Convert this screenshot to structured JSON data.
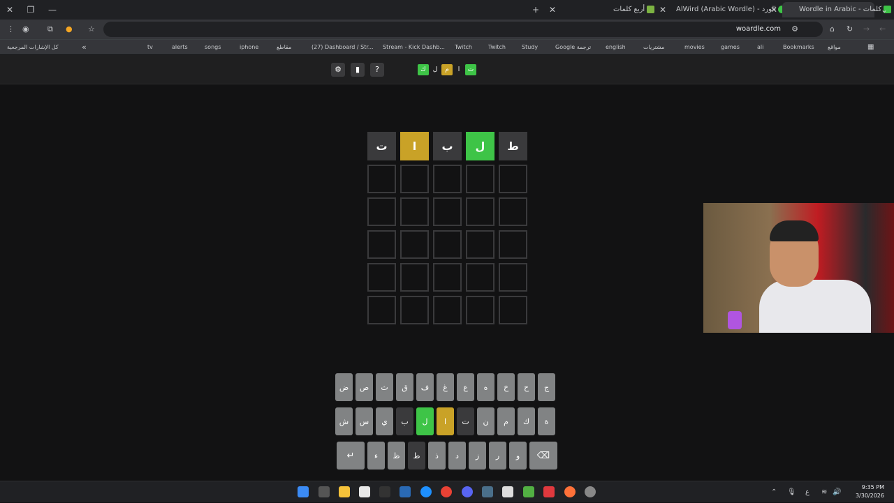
{
  "browser": {
    "tabs": [
      {
        "title": "Wordle in Arabic - كلمات",
        "active": true,
        "color": "#3ec447"
      },
      {
        "title": "AlWird (Arabic Wordle) - الورد",
        "active": false,
        "color": "#3ec447"
      },
      {
        "title": "أربع كلمات",
        "active": false,
        "color": "#7cb342"
      }
    ],
    "url": "woardle.com",
    "bookmarks": [
      "مواقع",
      "Bookmarks",
      "ali",
      "games",
      "movies",
      "مشتريات",
      "english",
      "Google ترجمة",
      "Study",
      "Twitch",
      "Twitch",
      "Stream - Kick Dashb...",
      "(27) Dashboard / Str...",
      "مقاطع",
      "iphone",
      "songs",
      "alerts",
      "tv"
    ],
    "all_bookmarks": "كل الإشارات المرجعية"
  },
  "header": {
    "settings_icon": "gear-icon",
    "stats_icon": "bar-chart-icon",
    "help_label": "?",
    "logo_letters": [
      {
        "char": "ك",
        "color": "#3ec447"
      },
      {
        "char": "ل",
        "color": ""
      },
      {
        "char": "م",
        "color": "#c9a227"
      },
      {
        "char": "ا",
        "color": ""
      },
      {
        "char": "ت",
        "color": "#3ec447"
      }
    ]
  },
  "board": {
    "rows": [
      [
        {
          "char": "ط",
          "state": "gray"
        },
        {
          "char": "ل",
          "state": "green"
        },
        {
          "char": "ب",
          "state": "gray"
        },
        {
          "char": "ا",
          "state": "yellow"
        },
        {
          "char": "ت",
          "state": "gray"
        }
      ],
      [
        {
          "char": "",
          "state": ""
        },
        {
          "char": "",
          "state": ""
        },
        {
          "char": "",
          "state": ""
        },
        {
          "char": "",
          "state": ""
        },
        {
          "char": "",
          "state": ""
        }
      ],
      [
        {
          "char": "",
          "state": ""
        },
        {
          "char": "",
          "state": ""
        },
        {
          "char": "",
          "state": ""
        },
        {
          "char": "",
          "state": ""
        },
        {
          "char": "",
          "state": ""
        }
      ],
      [
        {
          "char": "",
          "state": ""
        },
        {
          "char": "",
          "state": ""
        },
        {
          "char": "",
          "state": ""
        },
        {
          "char": "",
          "state": ""
        },
        {
          "char": "",
          "state": ""
        }
      ],
      [
        {
          "char": "",
          "state": ""
        },
        {
          "char": "",
          "state": ""
        },
        {
          "char": "",
          "state": ""
        },
        {
          "char": "",
          "state": ""
        },
        {
          "char": "",
          "state": ""
        }
      ],
      [
        {
          "char": "",
          "state": ""
        },
        {
          "char": "",
          "state": ""
        },
        {
          "char": "",
          "state": ""
        },
        {
          "char": "",
          "state": ""
        },
        {
          "char": "",
          "state": ""
        }
      ]
    ]
  },
  "keyboard": {
    "row1": [
      {
        "k": "ج",
        "s": ""
      },
      {
        "k": "ح",
        "s": ""
      },
      {
        "k": "خ",
        "s": ""
      },
      {
        "k": "ه",
        "s": ""
      },
      {
        "k": "ع",
        "s": ""
      },
      {
        "k": "غ",
        "s": ""
      },
      {
        "k": "ف",
        "s": ""
      },
      {
        "k": "ق",
        "s": ""
      },
      {
        "k": "ث",
        "s": ""
      },
      {
        "k": "ص",
        "s": ""
      },
      {
        "k": "ض",
        "s": ""
      }
    ],
    "row2": [
      {
        "k": "ة",
        "s": ""
      },
      {
        "k": "ك",
        "s": ""
      },
      {
        "k": "م",
        "s": ""
      },
      {
        "k": "ن",
        "s": ""
      },
      {
        "k": "ت",
        "s": "gray"
      },
      {
        "k": "ا",
        "s": "yellow"
      },
      {
        "k": "ل",
        "s": "green"
      },
      {
        "k": "ب",
        "s": "gray"
      },
      {
        "k": "ي",
        "s": ""
      },
      {
        "k": "س",
        "s": ""
      },
      {
        "k": "ش",
        "s": ""
      }
    ],
    "row3": [
      {
        "k": "⌫",
        "s": "",
        "wide": true
      },
      {
        "k": "و",
        "s": ""
      },
      {
        "k": "ر",
        "s": ""
      },
      {
        "k": "ز",
        "s": ""
      },
      {
        "k": "د",
        "s": ""
      },
      {
        "k": "ذ",
        "s": ""
      },
      {
        "k": "ط",
        "s": "gray"
      },
      {
        "k": "ظ",
        "s": ""
      },
      {
        "k": "ء",
        "s": ""
      },
      {
        "k": "↵",
        "s": "",
        "wide": true
      }
    ]
  },
  "taskbar": {
    "time": "9:35 PM",
    "date": "3/30/2026",
    "lang": "ع"
  }
}
